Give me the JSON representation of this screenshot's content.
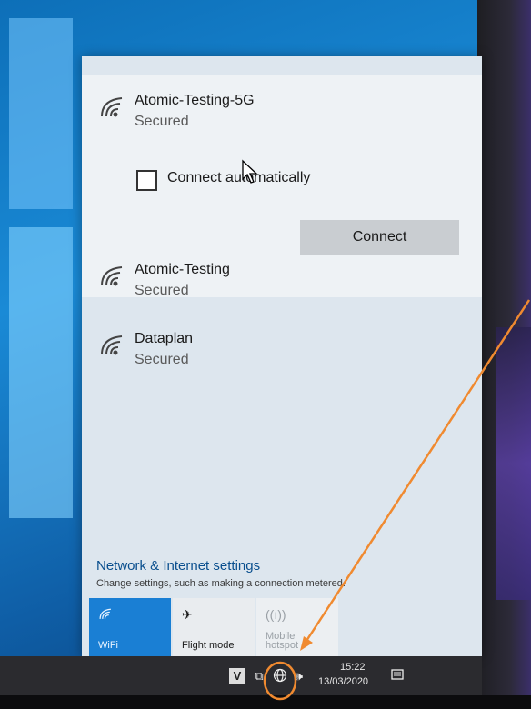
{
  "networks": [
    {
      "ssid": "Atomic-Testing-5G",
      "status": "Secured"
    },
    {
      "ssid": "Atomic-Testing",
      "status": "Secured"
    },
    {
      "ssid": "Dataplan",
      "status": "Secured"
    }
  ],
  "connect_automatically_label": "Connect automatically",
  "connect_button_label": "Connect",
  "settings": {
    "link": "Network & Internet settings",
    "description": "Change settings, such as making a connection metered."
  },
  "quick_actions": {
    "wifi": "WiFi",
    "flight_mode": "Flight mode",
    "mobile_hotspot_line1": "Mobile",
    "mobile_hotspot_line2": "hotspot"
  },
  "taskbar": {
    "time": "15:22",
    "date": "13/03/2020"
  },
  "colors": {
    "accent": "#1a7fd4",
    "annotation": "#f08a30"
  },
  "icons": [
    "wifi-icon",
    "airplane-icon",
    "hotspot-icon",
    "network-globe-icon",
    "volume-icon",
    "notification-icon"
  ]
}
